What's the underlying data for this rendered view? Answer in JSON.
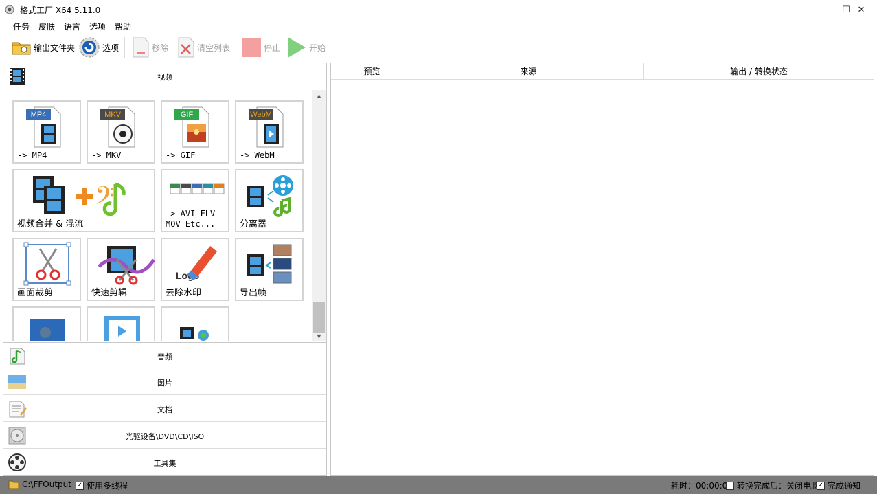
{
  "window": {
    "title": "格式工厂 X64 5.11.0",
    "minimize": "—",
    "maximize": "☐",
    "close": "✕"
  },
  "menu": [
    "任务",
    "皮肤",
    "语言",
    "选项",
    "帮助"
  ],
  "toolbar": {
    "output_folder": "输出文件夹",
    "options": "选项",
    "remove": "移除",
    "clear_list": "清空列表",
    "stop": "停止",
    "start": "开始"
  },
  "categories": {
    "video": "视频",
    "audio": "音频",
    "image": "图片",
    "document": "文档",
    "disc": "光驱设备\\DVD\\CD\\ISO",
    "tools": "工具集"
  },
  "tiles": {
    "mp4": "-> MP4",
    "mp4_badge": "MP4",
    "mkv": "-> MKV",
    "mkv_badge": "MKV",
    "gif": "-> GIF",
    "gif_badge": "GIF",
    "webm": "-> WebM",
    "webm_badge": "WebM",
    "merge": "视频合并 & 混流",
    "avi_flv": "-> AVI FLV\nMOV Etc...",
    "splitter": "分离器",
    "crop": "画面裁剪",
    "quick_cut": "快速剪辑",
    "logo_text": "Logo",
    "remove_watermark": "去除水印",
    "export_frames": "导出帧"
  },
  "table_headers": [
    "预览",
    "来源",
    "输出 / 转换状态"
  ],
  "status": {
    "output_path": "C:\\FFOutput",
    "multithread": "使用多线程",
    "elapsed": "耗时：00:00:00",
    "after_done": "转换完成后：关闭电脑",
    "notify": "完成通知"
  },
  "colors": {
    "statusbar": "#7a7a7a",
    "mp4_badge": "#3a6fb5",
    "mkv_badge": "#4a4a4a",
    "gif_badge": "#2ea84a",
    "webm_badge": "#4a4a4a",
    "webm_text": "#e8a020",
    "mkv_text": "#e8a020",
    "stop": "#f4a0a0",
    "start": "#80d080"
  }
}
